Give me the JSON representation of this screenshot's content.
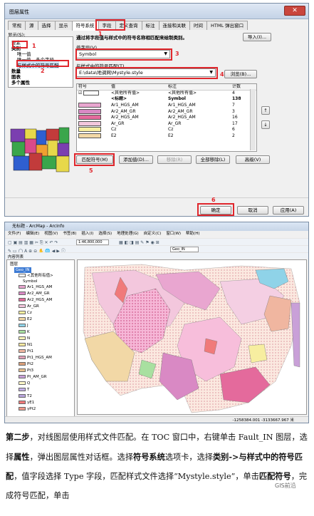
{
  "dialog": {
    "title": "图层属性",
    "close_label": "✕",
    "tabs": [
      "常规",
      "源",
      "选择",
      "显示",
      "符号系统",
      "字段",
      "定义查询",
      "标注",
      "连接和关联",
      "时间",
      "HTML 弹出窗口"
    ],
    "active_tab": "符号系统",
    "show_label": "显示(S):",
    "tree": {
      "features": "要素",
      "categories": "类别",
      "cat_items": [
        "唯一值",
        "唯一值，多个字段",
        "与样式中的符号匹配"
      ],
      "quantity": "数量",
      "charts": "图表",
      "multiple": "多个属性"
    },
    "description": "通过将字段值与样式中的符号名称相匹配来绘制类别。",
    "import_label": "导入(I)...",
    "value_field_label": "值字段(V)",
    "value_field": "Symbol",
    "style_label": "与样式中的符号匹配(T)",
    "style_path": "E:\\data\\地调网\\Mystyle.style",
    "browse_label": "浏览(B)...",
    "columns": [
      "符号",
      "值",
      "标注",
      "计数"
    ],
    "rows": [
      {
        "color": "#ffffff",
        "value": "<其他所有值>",
        "label": "<其他所有值>",
        "count": "4",
        "check": true
      },
      {
        "color": "",
        "value": "<标题>",
        "label": "Symbol",
        "count": "138",
        "bold": true
      },
      {
        "color": "#e9a6d0",
        "value": "Ar1_HGS_AM",
        "label": "Ar1_HGS_AM",
        "count": "7"
      },
      {
        "color": "#d989c4",
        "value": "Ar2_AM_GR",
        "label": "Ar2_AM_GR",
        "count": "3"
      },
      {
        "color": "#e46a9c",
        "value": "Ar2_HGS_AM",
        "label": "Ar2_HGS_AM",
        "count": "16"
      },
      {
        "color": "#f3c7dd",
        "value": "Ar_GR",
        "label": "Ar_GR",
        "count": "17"
      },
      {
        "color": "#f7eea0",
        "value": "Cz",
        "label": "Cz",
        "count": "6"
      },
      {
        "color": "#f2d8a6",
        "value": "E2",
        "label": "E2",
        "count": "2"
      }
    ],
    "match_button": "匹配符号(M)",
    "add_button": "添加值(D)...",
    "remove_button": "移除(R)",
    "remove_all_button": "全部移除(L)",
    "advanced_button": "高级(V)",
    "ok_button": "确定",
    "cancel_button": "取消",
    "apply_button": "应用(A)",
    "markers": [
      "1",
      "2",
      "3",
      "4",
      "5",
      "6"
    ]
  },
  "app": {
    "title": "无标题 - ArcMap - ArcInfo",
    "menu": [
      "文件(F)",
      "编辑(E)",
      "视图(V)",
      "书签(B)",
      "插入(I)",
      "选择(S)",
      "地理处理(G)",
      "自定义(C)",
      "窗口(W)",
      "帮助(H)"
    ],
    "scale": "1:46,800,000",
    "toc_title": "内容列表",
    "layers_label": "图层",
    "layer_name": "Geo_IN",
    "other_values": "<其他所有值>",
    "symbol_header": "Symbol",
    "toc_items": [
      {
        "name": "Ar1_HGS_AM",
        "color": "#e9a6d0"
      },
      {
        "name": "Ar2_AM_GR",
        "color": "#d989c4"
      },
      {
        "name": "Ar2_HGS_AM",
        "color": "#e46a9c"
      },
      {
        "name": "Ar_GR",
        "color": "#f3c7dd"
      },
      {
        "name": "Cz",
        "color": "#f7eea0"
      },
      {
        "name": "E2",
        "color": "#f2d8a6"
      },
      {
        "name": "J",
        "color": "#8fd3e8"
      },
      {
        "name": "K",
        "color": "#a8e0a0"
      },
      {
        "name": "N",
        "color": "#f9f3b8"
      },
      {
        "name": "N1",
        "color": "#fae8a0"
      },
      {
        "name": "Pt1",
        "color": "#f0b6a0"
      },
      {
        "name": "Pt1_HGS_AM",
        "color": "#e0a0b8"
      },
      {
        "name": "Pt2",
        "color": "#dba07a"
      },
      {
        "name": "Pt3",
        "color": "#e8c090"
      },
      {
        "name": "Pt_AM_GR",
        "color": "#c9a0d8"
      },
      {
        "name": "Q",
        "color": "#fff9c8"
      },
      {
        "name": "T",
        "color": "#c4b0e8"
      },
      {
        "name": "T2",
        "color": "#b8a4dc"
      },
      {
        "name": "γE1",
        "color": "#f07a7a"
      },
      {
        "name": "γPt2",
        "color": "#f09a8a"
      }
    ],
    "geo_layer_dropdown": "Geo_IN",
    "status_coords": "-1258384.001  -3133667.967 米"
  },
  "paragraph": {
    "step": "第二步",
    "text_a": "，对线图层使用样式文件匹配。在 TOC 窗口中，右键单击 Fault_IN 图层，选择",
    "b1": "属性",
    "text_b": "，弹出图层属性对话框。选择",
    "b2": "符号系统",
    "text_c": "选项卡，选择",
    "b3": "类别",
    "text_d": "->",
    "b4": "与样式中的符号匹配",
    "text_e": "，值字段选择 Type 字段，匹配样式文件选择“Mystyle.style”，单击",
    "b5": "匹配符号",
    "text_f": "，完成符号匹配，单击"
  },
  "watermark": "GIS前沿"
}
